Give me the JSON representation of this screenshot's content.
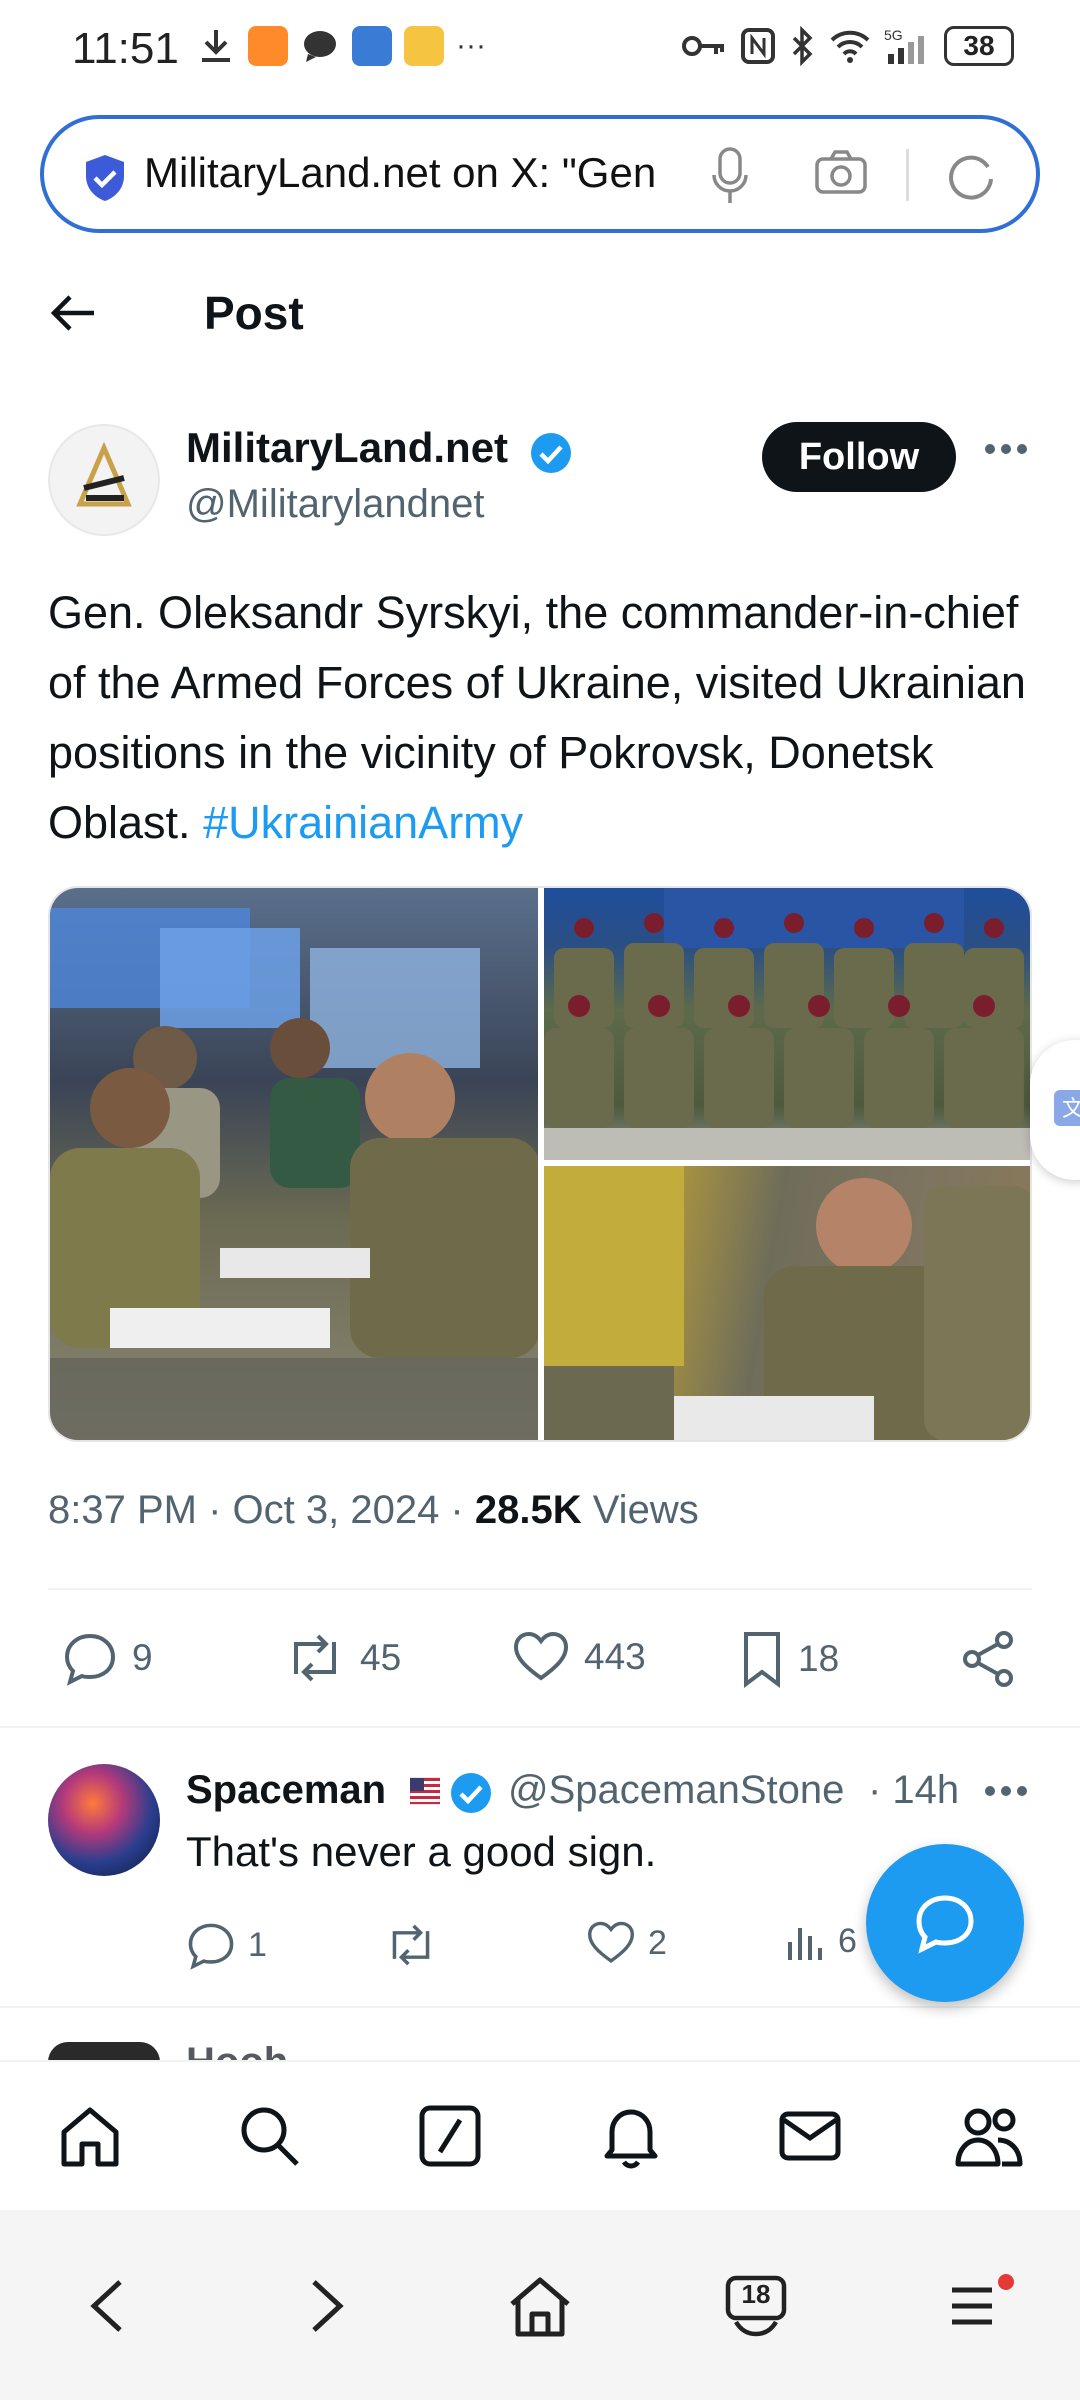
{
  "status_bar": {
    "time": "11:51",
    "dots": "···",
    "battery": "38",
    "network": "5G"
  },
  "url_bar": {
    "text": "MilitaryLand.net on X: \"Gen"
  },
  "header": {
    "title": "Post"
  },
  "post": {
    "author_name": "MilitaryLand.net",
    "author_handle": "@Militarylandnet",
    "follow_label": "Follow",
    "text": "Gen. Oleksandr Syrskyi, the commander-in-chief of the Armed Forces of Ukraine, visited Ukrainian positions in the vicinity of Pokrovsk, Donetsk Oblast. ",
    "hashtag": "#UkrainianArmy",
    "time": "8:37 PM · Oct 3, 2024 · ",
    "views_count": "28.5K",
    "views_label": " Views",
    "stats": {
      "replies": "9",
      "reposts": "45",
      "likes": "443",
      "bookmarks": "18"
    }
  },
  "reply": {
    "name": "Spaceman",
    "handle": "@SpacemanStone",
    "time": "· 14h",
    "text": "That's never a good sign.",
    "stats": {
      "replies": "1",
      "likes": "2",
      "views": "6"
    }
  },
  "peek": {
    "name": "Hooh"
  },
  "browser": {
    "tabs_count": "18"
  },
  "colors": {
    "accent": "#1d9bf0",
    "url_border": "#2f6fd6",
    "text_secondary": "#536471"
  }
}
